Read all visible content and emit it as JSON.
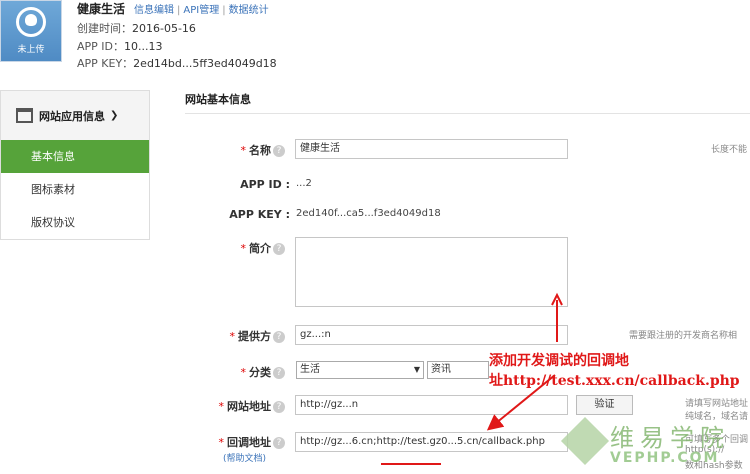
{
  "header": {
    "icon_caption": "未上传",
    "app_name": "健康生活",
    "links": [
      "信息编辑",
      "API管理",
      "数据统计"
    ],
    "created_label": "创建时间：",
    "created_value": "2016-05-16",
    "appid_label": "APP ID：",
    "appid_value": "10...13",
    "appkey_label": "APP KEY：",
    "appkey_value": "2ed14bd...5ff3ed4049d18"
  },
  "sidebar": {
    "title": "网站应用信息",
    "items": [
      {
        "label": "基本信息",
        "active": true
      },
      {
        "label": "图标素材",
        "active": false
      },
      {
        "label": "版权协议",
        "active": false
      }
    ]
  },
  "main": {
    "section_title": "网站基本信息",
    "name_label": "名称",
    "name_value": "健康生活",
    "name_hint": "长度不能",
    "appid_label": "APP ID :",
    "appid_value": "...2",
    "appkey_label": "APP KEY :",
    "appkey_value": "2ed140f...ca5...f3ed4049d18",
    "intro_label": "简介",
    "provider_label": "提供方",
    "provider_value": "gz...:n",
    "provider_hint": "需要跟注册的开发商名称相",
    "category_label": "分类",
    "category_primary": "生活",
    "category_secondary": "资讯",
    "website_label": "网站地址",
    "website_value": "http://gz...n",
    "verify_button": "验证",
    "website_hint": [
      "请填写网站地址",
      "纯域名，域名请"
    ],
    "callback_label": "回调地址",
    "callback_value": "http://gz...6.cn;http://test.gz0...5.cn/callback.php",
    "callback_hint": [
      "可填写多个回调",
      "http(s)://",
      "数和hash参数"
    ],
    "help_link": "(帮助文档)"
  },
  "annotation": {
    "line1": "添加开发调试的回调地",
    "line2": "址http://test.xxx.cn/callback.php"
  },
  "watermark": {
    "cn": "维易学院",
    "en": "VEPHP.COM"
  },
  "colors": {
    "accent_green": "#56a33a",
    "link_blue": "#3b73b9",
    "annotation_red": "#e01818"
  }
}
